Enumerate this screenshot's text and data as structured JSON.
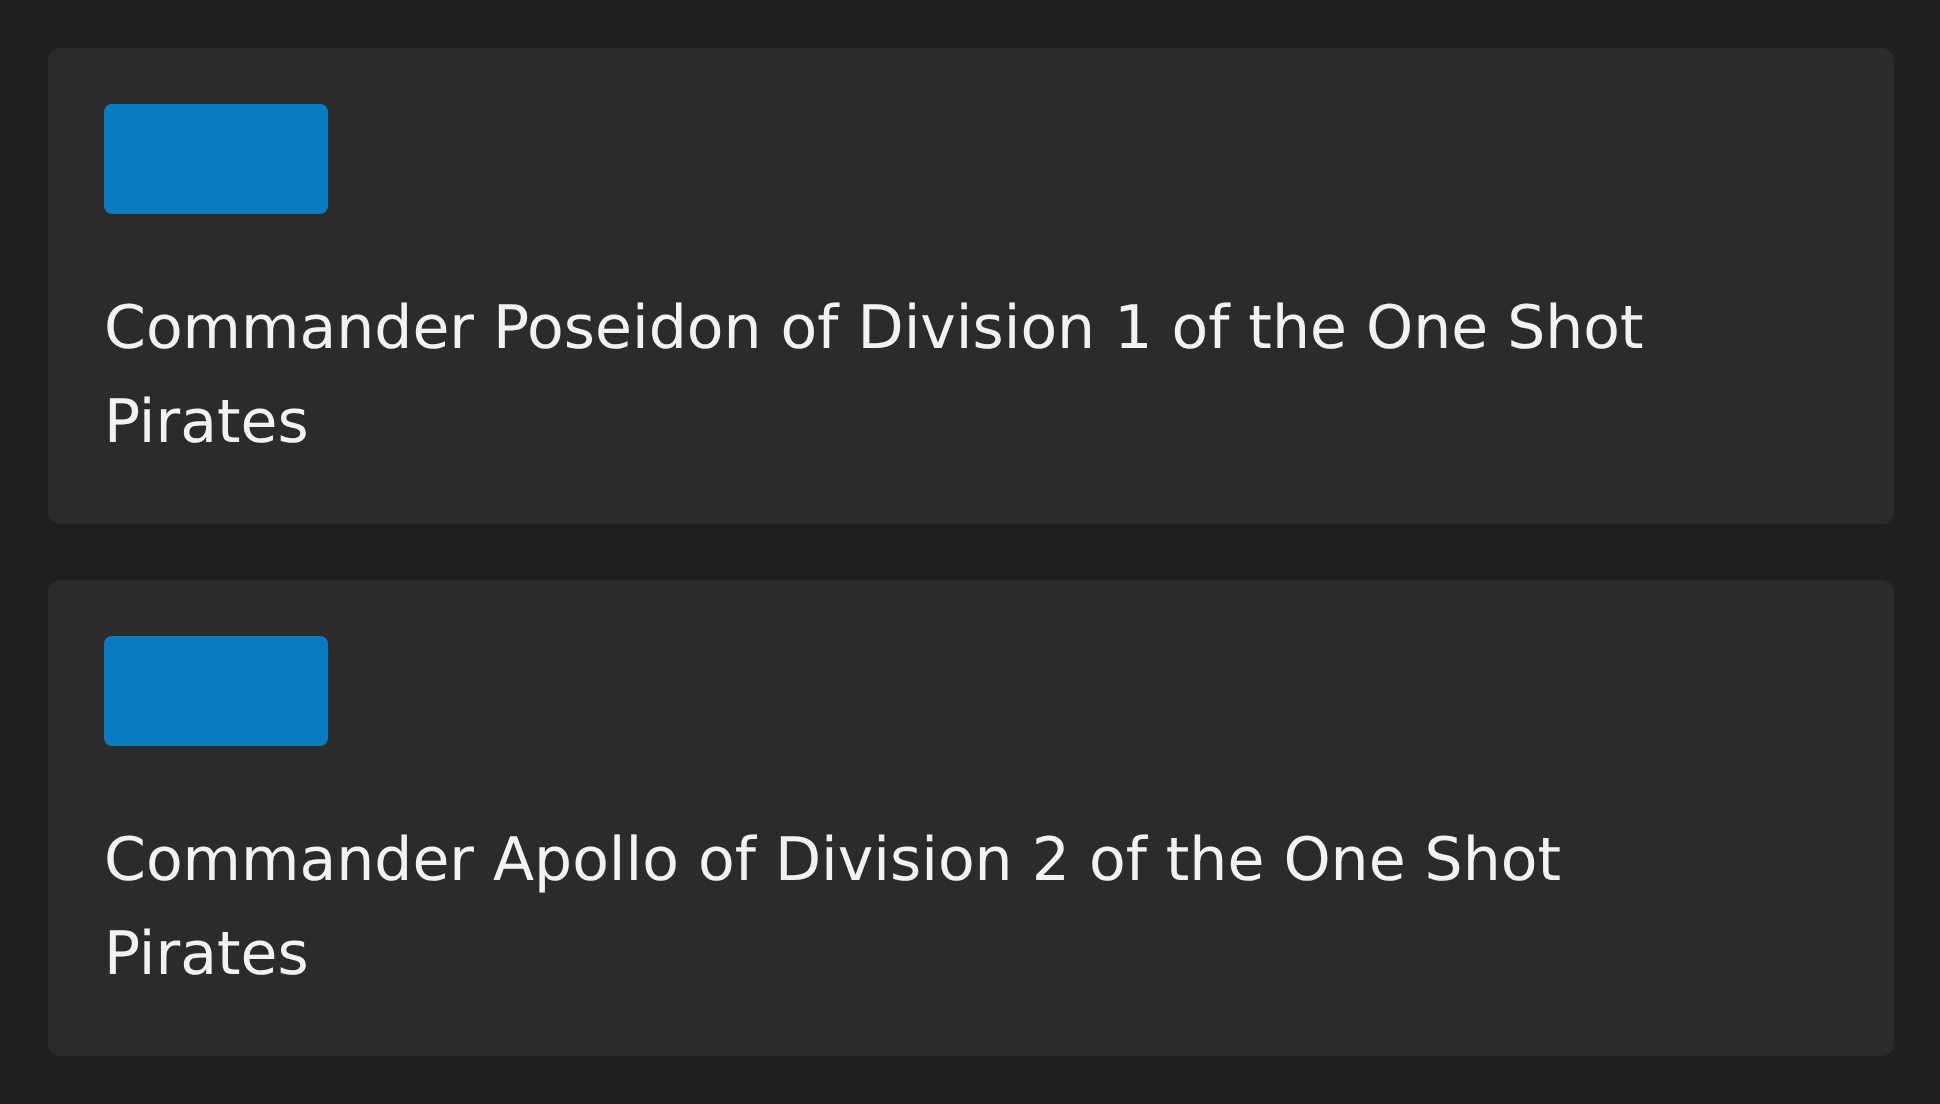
{
  "cards": [
    {
      "title": "Commander Poseidon of Division 1 of the One Shot Pirates"
    },
    {
      "title": "Commander Apollo of Division 2 of the One Shot Pirates"
    }
  ]
}
